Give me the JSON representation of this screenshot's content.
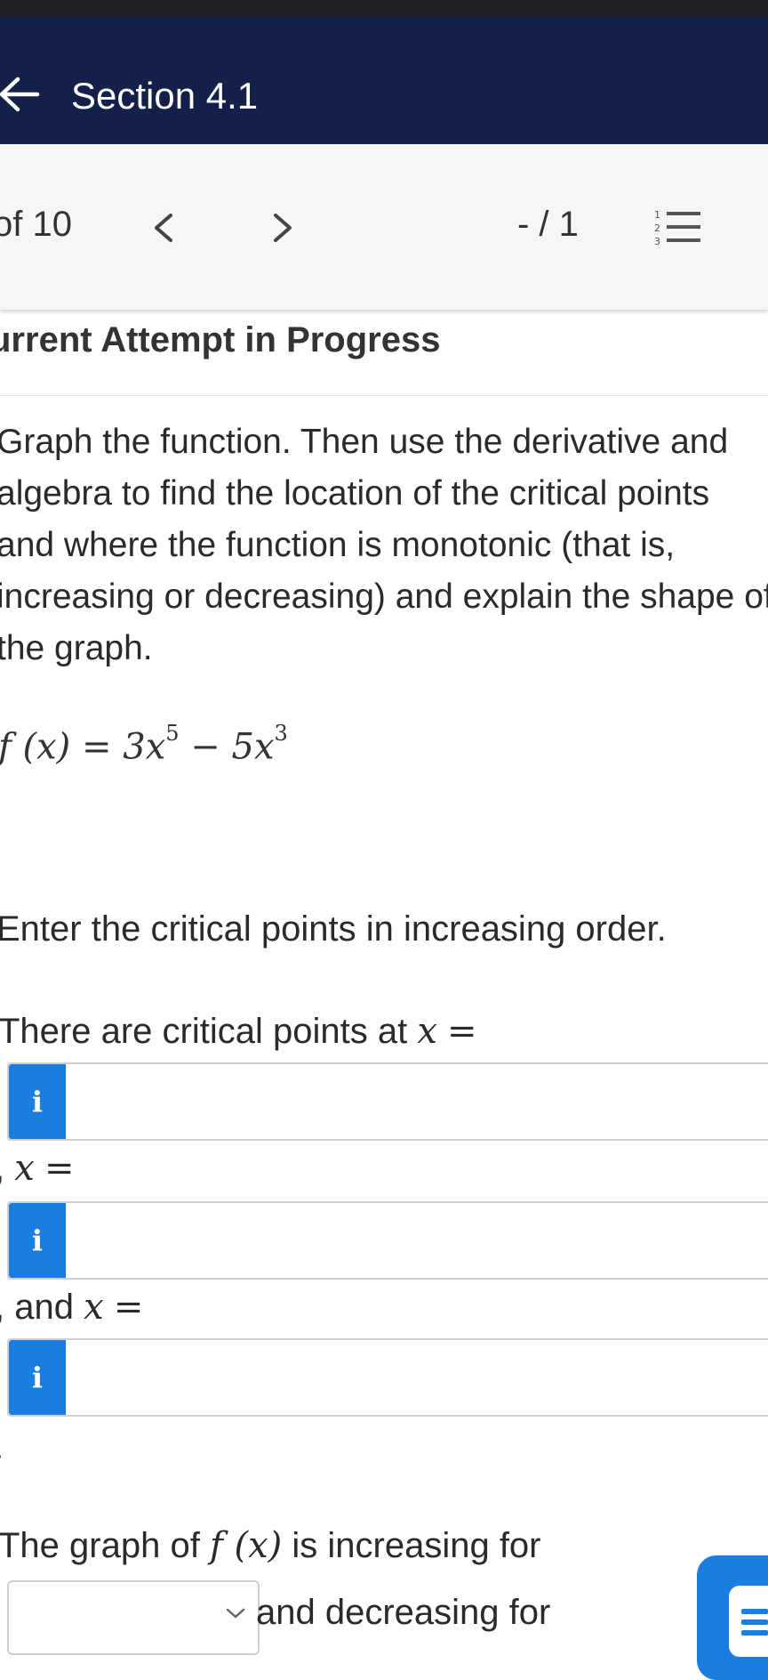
{
  "header": {
    "title": "Section 4.1"
  },
  "toolbar": {
    "question_of": "of 10",
    "score": "- / 1"
  },
  "attempt": {
    "status": "urrent Attempt in Progress"
  },
  "question": {
    "text": "Graph the function. Then use the derivative and\nalgebra to find the location of the critical points\nand where the function is monotonic (that is,\nincreasing or decreasing) and explain the shape of\nthe graph.",
    "formula": {
      "lhs": "f (x)",
      "eq": "=",
      "t1": "3x",
      "e1": "5",
      "minus": "−",
      "t2": "5x",
      "e2": "3"
    },
    "instruction": "Enter the critical points in increasing order.",
    "critical_label": "There are critical points at",
    "var_x": "x",
    "equals": "=",
    "sep_comma": ",",
    "sep_and": "and",
    "info_icon_text": "i",
    "graph_text_before": "The graph of",
    "graph_fx": "f (x)",
    "graph_text_after": "is increasing for",
    "decreasing_text": "and decreasing for"
  },
  "colors": {
    "header_bg": "#13204a",
    "accent": "#1a7ee0"
  }
}
